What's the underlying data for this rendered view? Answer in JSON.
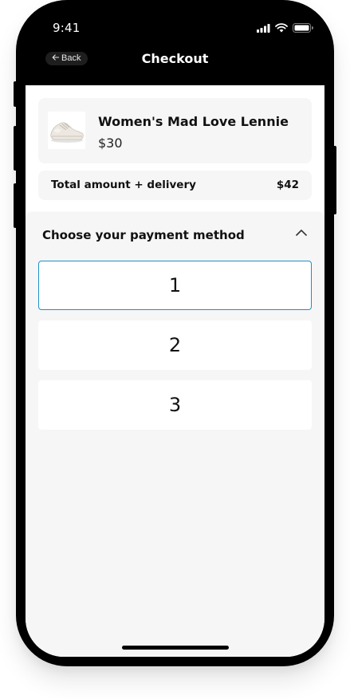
{
  "status_bar": {
    "time": "9:41"
  },
  "header": {
    "back_label": "Back",
    "title": "Checkout"
  },
  "product": {
    "name": "Women's Mad Love Lennie",
    "price": "$30"
  },
  "total": {
    "label": "Total amount + delivery",
    "value": "$42"
  },
  "payment": {
    "title": "Choose your payment method",
    "options": [
      {
        "label": "1",
        "selected": true
      },
      {
        "label": "2",
        "selected": false
      },
      {
        "label": "3",
        "selected": false
      }
    ]
  },
  "colors": {
    "header_background": "#000000",
    "card_background": "#f6f6f6",
    "selected_border": "#1e90c8"
  },
  "icons": [
    "signal-icon",
    "wifi-icon",
    "battery-icon",
    "back-arrow-icon",
    "chevron-up-icon",
    "shoe-thumbnail"
  ]
}
